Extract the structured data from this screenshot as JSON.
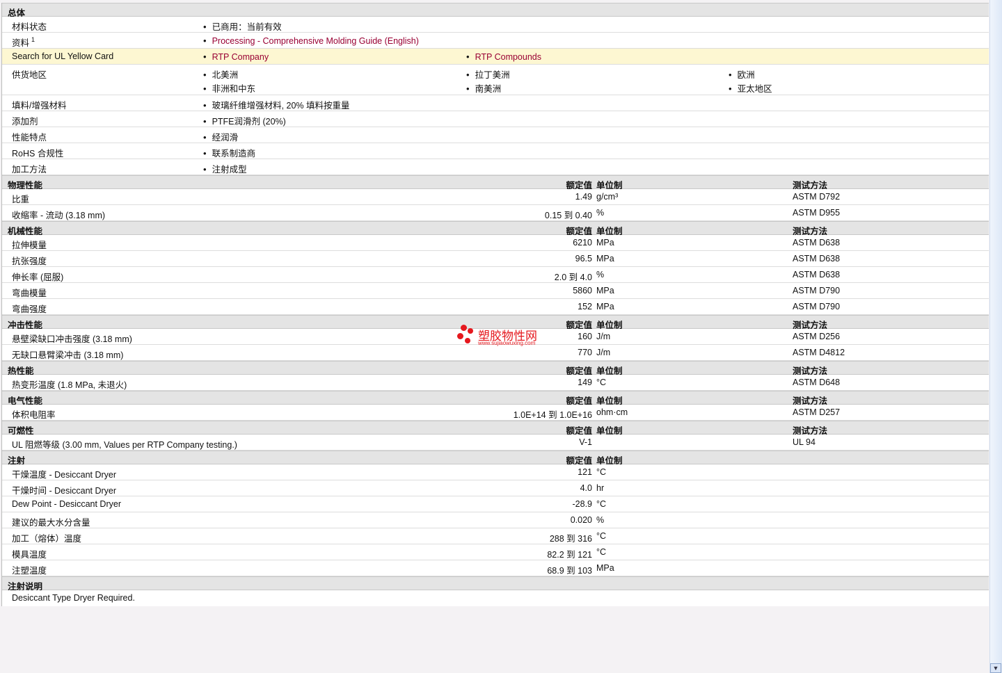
{
  "general": {
    "title": "总体",
    "rows": [
      {
        "label": "材料状态",
        "items": [
          "已商用：当前有效"
        ]
      },
      {
        "label": "资料",
        "sup": "1",
        "links": [
          "Processing - Comprehensive Molding Guide (English)"
        ]
      },
      {
        "label": "Search for UL Yellow Card",
        "links": [
          "RTP Company",
          "RTP Compounds"
        ]
      },
      {
        "label": "供货地区",
        "items": [
          "北美洲",
          "拉丁美洲",
          "欧洲",
          "非洲和中东",
          "南美洲",
          "亚太地区"
        ]
      },
      {
        "label": "填料/增强材料",
        "items": [
          "玻璃纤维增强材料, 20% 填料按重量"
        ]
      },
      {
        "label": "添加剂",
        "items": [
          "PTFE润滑剂 (20%)"
        ]
      },
      {
        "label": "性能特点",
        "items": [
          "经润滑"
        ]
      },
      {
        "label": "RoHS 合规性",
        "items": [
          "联系制造商"
        ]
      },
      {
        "label": "加工方法",
        "items": [
          "注射成型"
        ]
      }
    ]
  },
  "col_headers": {
    "value": "额定值",
    "unit": "单位制",
    "method": "测试方法"
  },
  "sections": [
    {
      "title": "物理性能",
      "method": true,
      "rows": [
        [
          "比重",
          "1.49",
          "g/cm³",
          "ASTM D792"
        ],
        [
          "收缩率  - 流动  (3.18 mm)",
          "0.15 到  0.40",
          "%",
          "ASTM D955"
        ]
      ]
    },
    {
      "title": "机械性能",
      "method": true,
      "rows": [
        [
          "拉伸模量",
          "6210",
          "MPa",
          "ASTM D638"
        ],
        [
          "抗张强度",
          "96.5",
          "MPa",
          "ASTM D638"
        ],
        [
          "伸长率  (屈服)",
          "2.0 到  4.0",
          "%",
          "ASTM D638"
        ],
        [
          "弯曲模量",
          "5860",
          "MPa",
          "ASTM D790"
        ],
        [
          "弯曲强度",
          "152",
          "MPa",
          "ASTM D790"
        ]
      ]
    },
    {
      "title": "冲击性能",
      "method": true,
      "rows": [
        [
          "悬壁梁缺口冲击强度  (3.18 mm)",
          "160",
          "J/m",
          "ASTM D256"
        ],
        [
          "无缺口悬臂梁冲击  (3.18 mm)",
          "770",
          "J/m",
          "ASTM D4812"
        ]
      ]
    },
    {
      "title": "热性能",
      "method": true,
      "rows": [
        [
          "热变形温度  (1.8 MPa, 未退火)",
          "149",
          "°C",
          "ASTM D648"
        ]
      ]
    },
    {
      "title": "电气性能",
      "method": true,
      "rows": [
        [
          "体积电阻率",
          "1.0E+14 到  1.0E+16",
          "ohm·cm",
          "ASTM D257"
        ]
      ]
    },
    {
      "title": "可燃性",
      "method": true,
      "rows": [
        [
          "UL 阻燃等级  (3.00 mm, Values per RTP Company testing.)",
          "V-1",
          "",
          "UL 94"
        ]
      ]
    },
    {
      "title": "注射",
      "method": false,
      "rows": [
        [
          "干燥温度  - Desiccant Dryer",
          "121",
          "°C",
          ""
        ],
        [
          "干燥时间  - Desiccant Dryer",
          "4.0",
          "hr",
          ""
        ],
        [
          "Dew Point - Desiccant Dryer",
          "-28.9",
          "°C",
          ""
        ],
        [
          "建议的最大水分含量",
          "0.020",
          "%",
          ""
        ],
        [
          "加工（熔体）温度",
          "288 到  316",
          "°C",
          ""
        ],
        [
          "模具温度",
          "82.2 到  121",
          "°C",
          ""
        ],
        [
          "注塑温度",
          "68.9 到  103",
          "MPa",
          ""
        ]
      ]
    }
  ],
  "notes": {
    "title": "注射说明",
    "text": "Desiccant Type Dryer Required."
  },
  "watermark": {
    "name": "塑胶物性网",
    "url": "www.sujiaowuxing.com"
  }
}
